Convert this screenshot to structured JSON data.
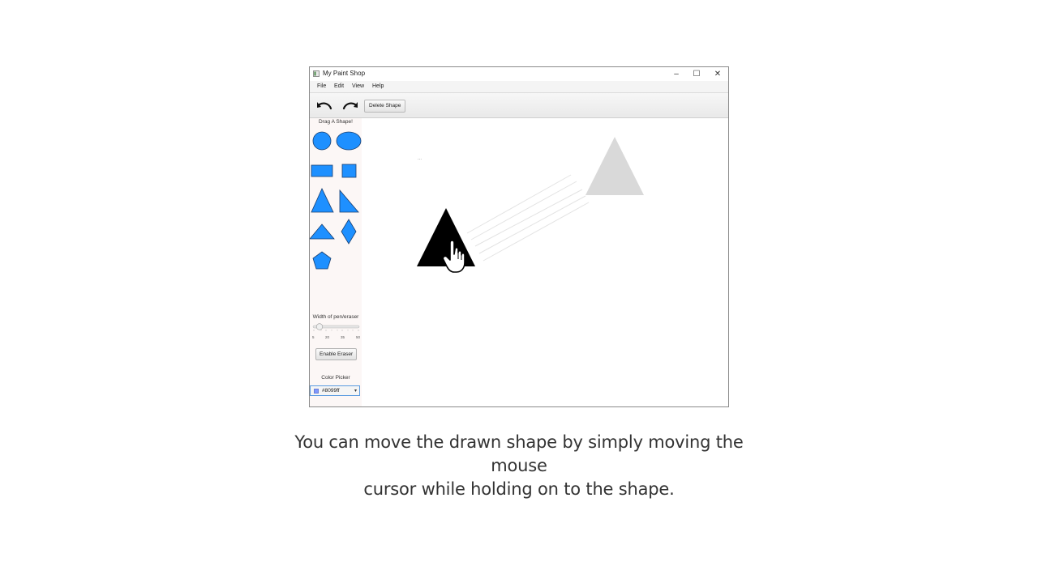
{
  "window": {
    "title": "My Paint Shop",
    "controls": {
      "minimize": "–",
      "maximize": "☐",
      "close": "✕"
    }
  },
  "menu": [
    {
      "label": "File"
    },
    {
      "label": "Edit"
    },
    {
      "label": "View"
    },
    {
      "label": "Help"
    }
  ],
  "toolbar": {
    "undo_icon": "undo-icon",
    "redo_icon": "redo-icon",
    "delete_label": "Delete Shape"
  },
  "sidebar": {
    "drag_label": "Drag A Shape!",
    "shapes": [
      "circle",
      "ellipse",
      "rectangle",
      "square",
      "triangle",
      "right-triangle",
      "flat-triangle",
      "diamond",
      "pentagon"
    ],
    "shape_color": "#1e90ff",
    "width_label": "Width of pen/eraser",
    "slider": {
      "ticks": [
        "5",
        "20",
        "35",
        "50"
      ],
      "value": 5,
      "min": 5,
      "max": 50
    },
    "eraser_label": "Enable Eraser",
    "color_picker_label": "Color Picker",
    "color_value": "#8099ff"
  },
  "canvas": {
    "dot_text": "...",
    "ghost_color": "#d9d9d9",
    "shape_color": "#000000"
  },
  "caption": {
    "line1": "You can move the drawn shape by simply moving the mouse",
    "line2": "cursor while holding on to the shape."
  }
}
